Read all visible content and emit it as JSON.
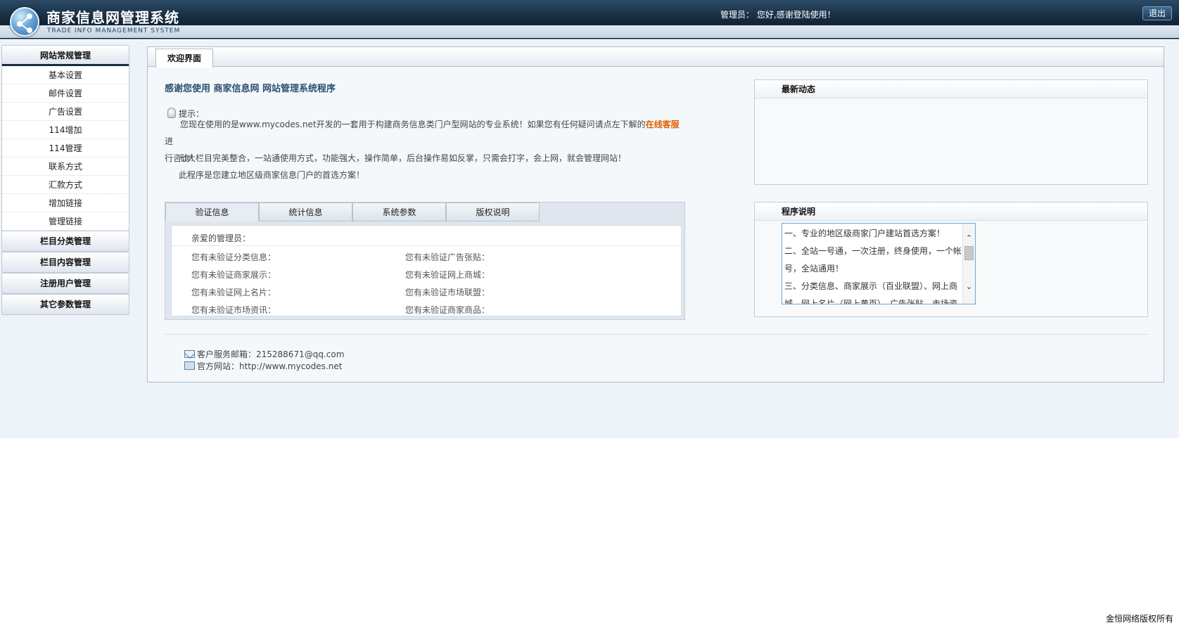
{
  "header": {
    "title": "商家信息网管理系统",
    "subtitle": "TRADE INFO MANAGEMENT SYSTEM",
    "welcome": "管理员： 您好,感谢登陆使用！",
    "logout": "退出"
  },
  "sidebar": {
    "group1": {
      "title": "网站常规管理",
      "items": [
        "基本设置",
        "邮件设置",
        "广告设置",
        "114增加",
        "114管理",
        "联系方式",
        "汇款方式",
        "增加链接",
        "管理链接"
      ]
    },
    "groups": [
      "栏目分类管理",
      "栏目内容管理",
      "注册用户管理",
      "其它参数管理"
    ]
  },
  "main": {
    "tab": "欢迎界面",
    "intro_title": "感谢您使用 商家信息网 网站管理系统程序",
    "tip_label": "提示：",
    "para1_a": "您现在使用的是www.mycodes.net开发的一套用于构建商务信息类门户型网站的专业系统！如果您有任何疑问请点左下解的",
    "para1_link": "在线客服",
    "para1_b": "进",
    "para1_c": "行咨询！",
    "para2": "七大栏目完美整合，一站通使用方式，功能强大，操作简单，后台操作易如反掌，只需会打字，会上网，就会管理网站！",
    "para3": "此程序是您建立地区级商家信息门户的首选方案！",
    "info_tabs": [
      "验证信息",
      "统计信息",
      "系统参数",
      "版权说明"
    ],
    "info_greeting": "亲爱的管理员：",
    "info_left": [
      "您有未验证分类信息：",
      "您有未验证商家展示：",
      "您有未验证网上名片：",
      "您有未验证市场资讯："
    ],
    "info_right": [
      "您有未验证广告张贴：",
      "您有未验证网上商城：",
      "您有未验证市场联盟：",
      "您有未验证商家商品："
    ],
    "news_title": "最新动态",
    "prog_title": "程序说明",
    "prog_lines": [
      "一、专业的地区级商家门户建站首选方案！",
      "二、全站一号通，一次注册，终身使用，一个帐号，全站通用！",
      "三、分类信息、商家展示（百业联盟）、网上商城、网上名片（网上黄页）、广告张贴、市场资讯"
    ],
    "contact_email": "客户服务邮箱：215288671@qq.com",
    "contact_site": "官方网站：http://www.mycodes.net"
  },
  "footer": {
    "copyright": "金恒网络版权所有"
  }
}
